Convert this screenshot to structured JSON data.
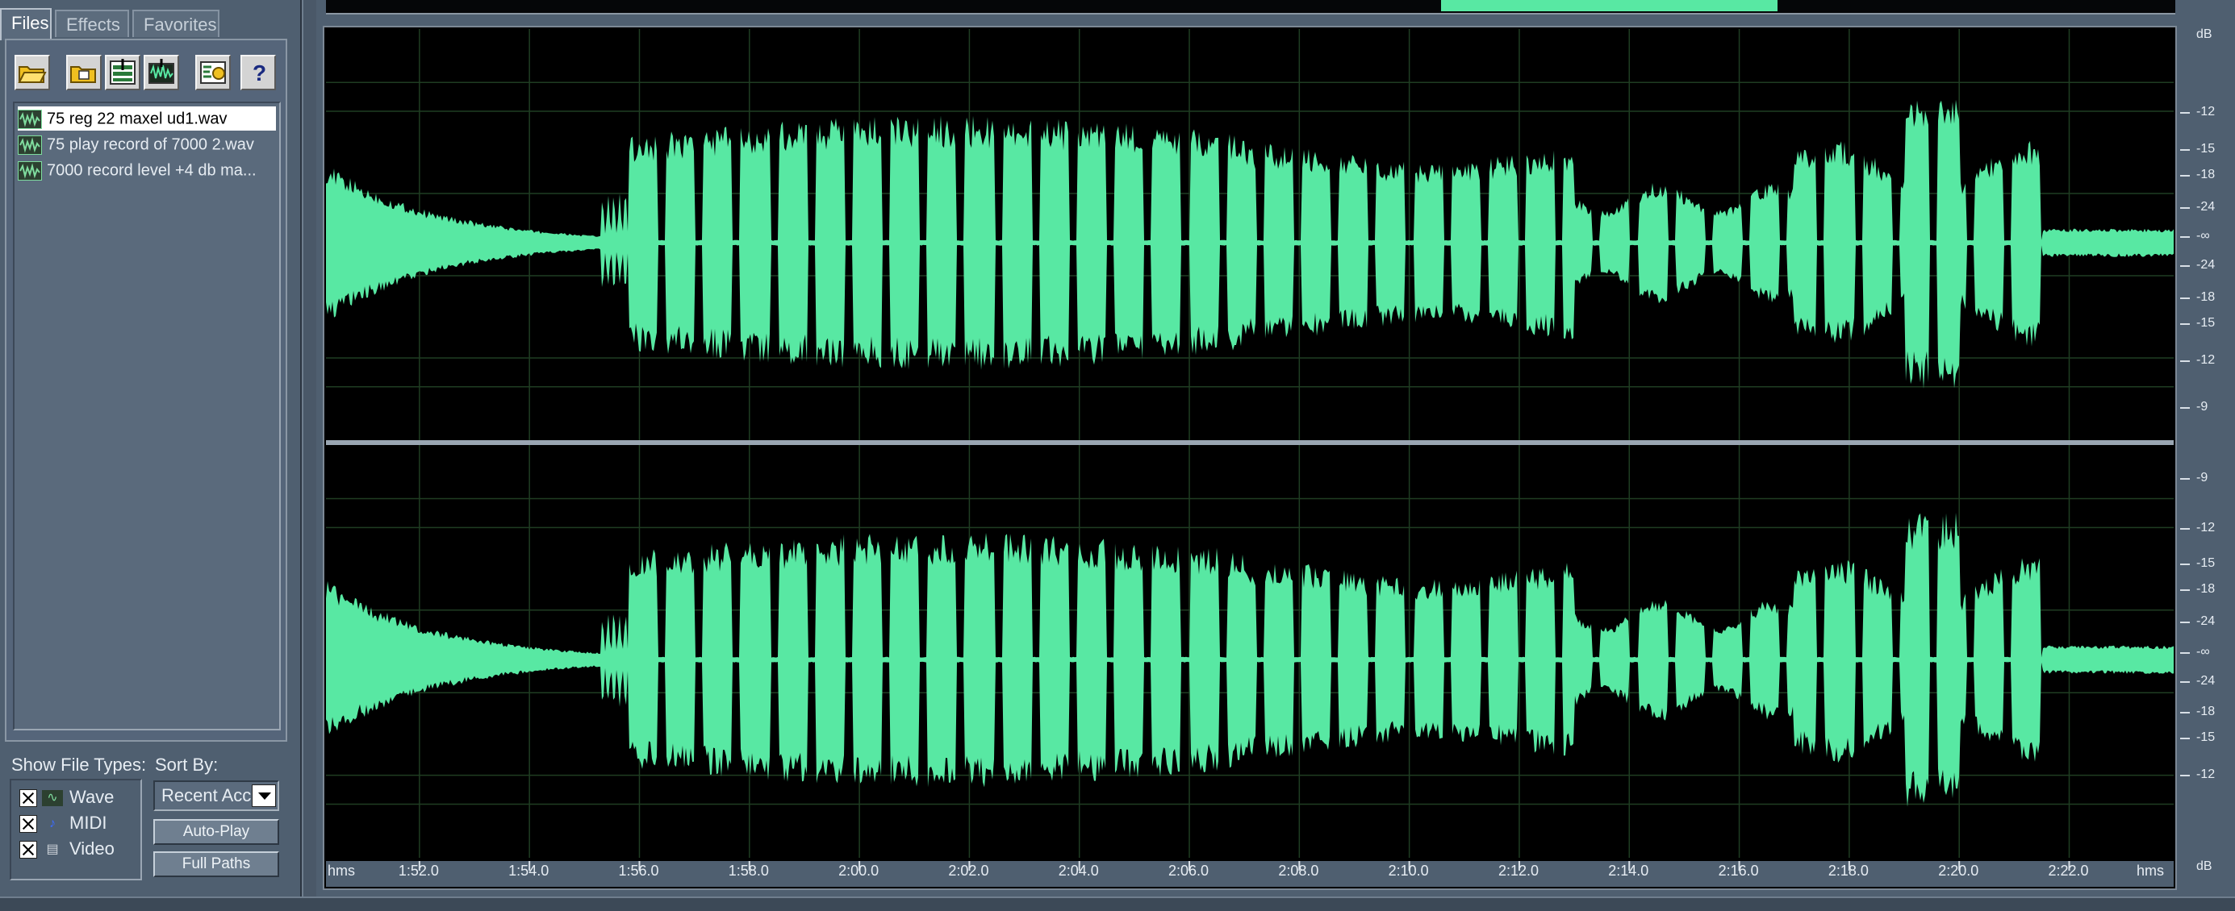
{
  "tabs": [
    {
      "label": "Files",
      "active": true
    },
    {
      "label": "Effects",
      "active": false
    },
    {
      "label": "Favorites",
      "active": false
    }
  ],
  "toolbar_icons": [
    "open-file-icon",
    "close-file-icon",
    "insert-into-multitrack-icon",
    "edit-file-icon",
    "options-icon",
    "help-icon"
  ],
  "files": [
    {
      "name": "75 reg 22 maxel ud1.wav",
      "selected": true
    },
    {
      "name": "75 play record of 7000 2.wav",
      "selected": false
    },
    {
      "name": "7000 record level  +4 db ma...",
      "selected": false
    }
  ],
  "show_file_types": {
    "label": "Show File Types:",
    "items": [
      {
        "label": "Wave",
        "checked": true,
        "icon": "wave-type-icon"
      },
      {
        "label": "MIDI",
        "checked": true,
        "icon": "midi-type-icon"
      },
      {
        "label": "Video",
        "checked": true,
        "icon": "video-type-icon"
      }
    ]
  },
  "sort_by": {
    "label": "Sort By:",
    "value": "Recent Acc"
  },
  "buttons": {
    "auto_play": "Auto-Play",
    "full_paths": "Full Paths"
  },
  "colors": {
    "waveform": "#58e8a3",
    "background": "#000000",
    "grid": "#1c3a1e",
    "panel": "#4f5f70"
  },
  "overview": {
    "visible_start_fraction": 0.603,
    "visible_end_fraction": 0.785
  },
  "time_ruler": {
    "unit_left": "hms",
    "unit_right": "hms",
    "ticks": [
      "1:52.0",
      "1:54.0",
      "1:56.0",
      "1:58.0",
      "2:00.0",
      "2:02.0",
      "2:04.0",
      "2:06.0",
      "2:08.0",
      "2:10.0",
      "2:12.0",
      "2:14.0",
      "2:16.0",
      "2:18.0",
      "2:20.0",
      "2:22.0"
    ],
    "start_seconds": 110.3,
    "end_seconds": 143.9
  },
  "db_ruler": {
    "unit": "dB",
    "channel_top": [
      "-12",
      "-15",
      "-18",
      "-24",
      "-∞",
      "-24",
      "-18",
      "-15",
      "-12",
      "-9"
    ],
    "channel_bottom": [
      "-9",
      "-12",
      "-15",
      "-18",
      "-24",
      "-∞",
      "-24",
      "-18",
      "-15",
      "-12"
    ],
    "unit_bottom": "dB"
  },
  "waveform_envelope": {
    "description_free": true,
    "segments": [
      {
        "t0": 110.3,
        "t1": 115.3,
        "type": "decay",
        "a0": 0.34,
        "a1": 0.03
      },
      {
        "t0": 115.3,
        "t1": 115.8,
        "type": "burst",
        "a0": 0.22,
        "a1": 0.22
      },
      {
        "t0": 115.8,
        "t1": 141.5,
        "type": "tones",
        "a0": 0.55,
        "a1": 0.55
      },
      {
        "t0": 141.5,
        "t1": 143.9,
        "type": "hiss",
        "a0": 0.06,
        "a1": 0.06
      }
    ]
  }
}
